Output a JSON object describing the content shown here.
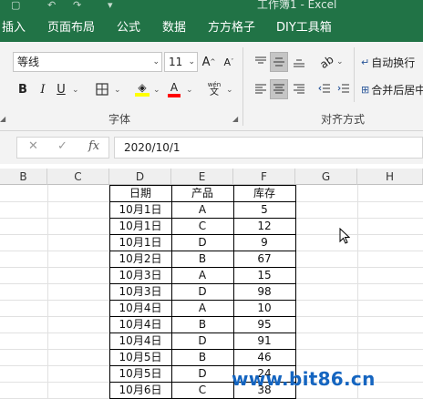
{
  "window": {
    "title": "工作簿1 - Excel"
  },
  "ribbon_tabs": [
    "插入",
    "页面布局",
    "公式",
    "数据",
    "方方格子",
    "DIY工具箱"
  ],
  "font_group": {
    "font_name": "等线",
    "font_size": "11",
    "label": "字体",
    "bold": "B",
    "italic": "I",
    "underline": "U",
    "grow_font": "A",
    "shrink_font": "A",
    "font_color_letter": "A",
    "phonetic": "wén"
  },
  "alignment_group": {
    "label": "对齐方式",
    "wrap_text": "自动换行",
    "merge_center": "合并后居中"
  },
  "formula_bar": {
    "fx": "fx",
    "value": "2020/10/1"
  },
  "columns": [
    "B",
    "C",
    "D",
    "E",
    "F",
    "G",
    "H"
  ],
  "table": {
    "headers": [
      "日期",
      "产品",
      "库存"
    ],
    "rows": [
      [
        "10月1日",
        "A",
        "5"
      ],
      [
        "10月1日",
        "C",
        "12"
      ],
      [
        "10月1日",
        "D",
        "9"
      ],
      [
        "10月2日",
        "B",
        "67"
      ],
      [
        "10月3日",
        "A",
        "15"
      ],
      [
        "10月3日",
        "D",
        "98"
      ],
      [
        "10月4日",
        "A",
        "10"
      ],
      [
        "10月4日",
        "B",
        "95"
      ],
      [
        "10月4日",
        "D",
        "91"
      ],
      [
        "10月5日",
        "B",
        "46"
      ],
      [
        "10月5日",
        "D",
        "24"
      ],
      [
        "10月6日",
        "C",
        "38"
      ]
    ]
  },
  "watermark": "www.bit86.cn",
  "colors": {
    "ribbon_green": "#217346",
    "accent_blue": "#1565c0",
    "highlight_yellow": "#ffff00",
    "font_red": "#ff0000"
  }
}
